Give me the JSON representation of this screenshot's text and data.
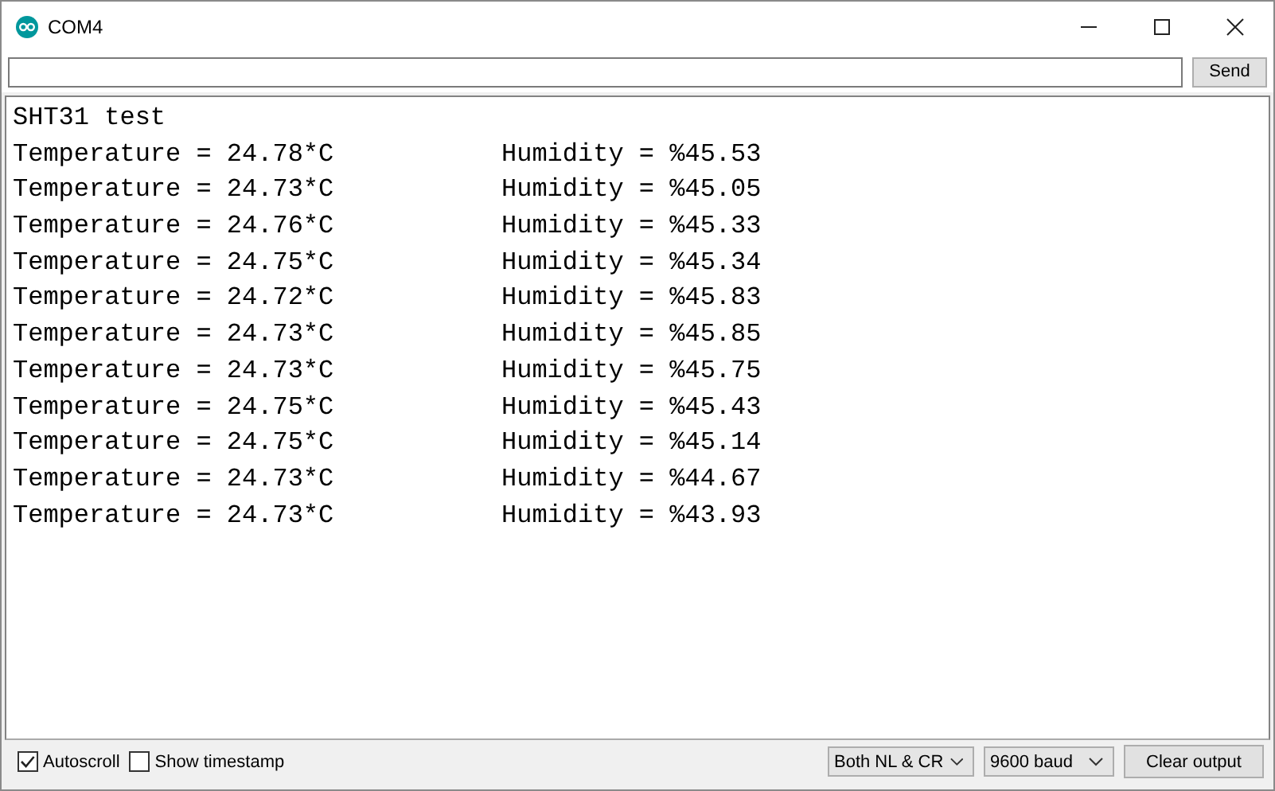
{
  "window": {
    "title": "COM4"
  },
  "send_bar": {
    "button": "Send"
  },
  "output": {
    "header": "SHT31 test",
    "lines": [
      {
        "temperature": "Temperature = 24.78*C",
        "humidity": "Humidity = %45.53"
      },
      {
        "temperature": "Temperature = 24.73*C",
        "humidity": "Humidity = %45.05"
      },
      {
        "temperature": "Temperature = 24.76*C",
        "humidity": "Humidity = %45.33"
      },
      {
        "temperature": "Temperature = 24.75*C",
        "humidity": "Humidity = %45.34"
      },
      {
        "temperature": "Temperature = 24.72*C",
        "humidity": "Humidity = %45.83"
      },
      {
        "temperature": "Temperature = 24.73*C",
        "humidity": "Humidity = %45.85"
      },
      {
        "temperature": "Temperature = 24.73*C",
        "humidity": "Humidity = %45.75"
      },
      {
        "temperature": "Temperature = 24.75*C",
        "humidity": "Humidity = %45.43"
      },
      {
        "temperature": "Temperature = 24.75*C",
        "humidity": "Humidity = %45.14"
      },
      {
        "temperature": "Temperature = 24.73*C",
        "humidity": "Humidity = %44.67"
      },
      {
        "temperature": "Temperature = 24.73*C",
        "humidity": "Humidity = %43.93"
      }
    ]
  },
  "status_bar": {
    "checkboxes": [
      {
        "label": "Autoscroll",
        "checked": true
      },
      {
        "label": "Show timestamp",
        "checked": false
      }
    ],
    "dropdowns": [
      "Both NL & CR",
      "9600 baud"
    ],
    "button": "Clear output"
  }
}
